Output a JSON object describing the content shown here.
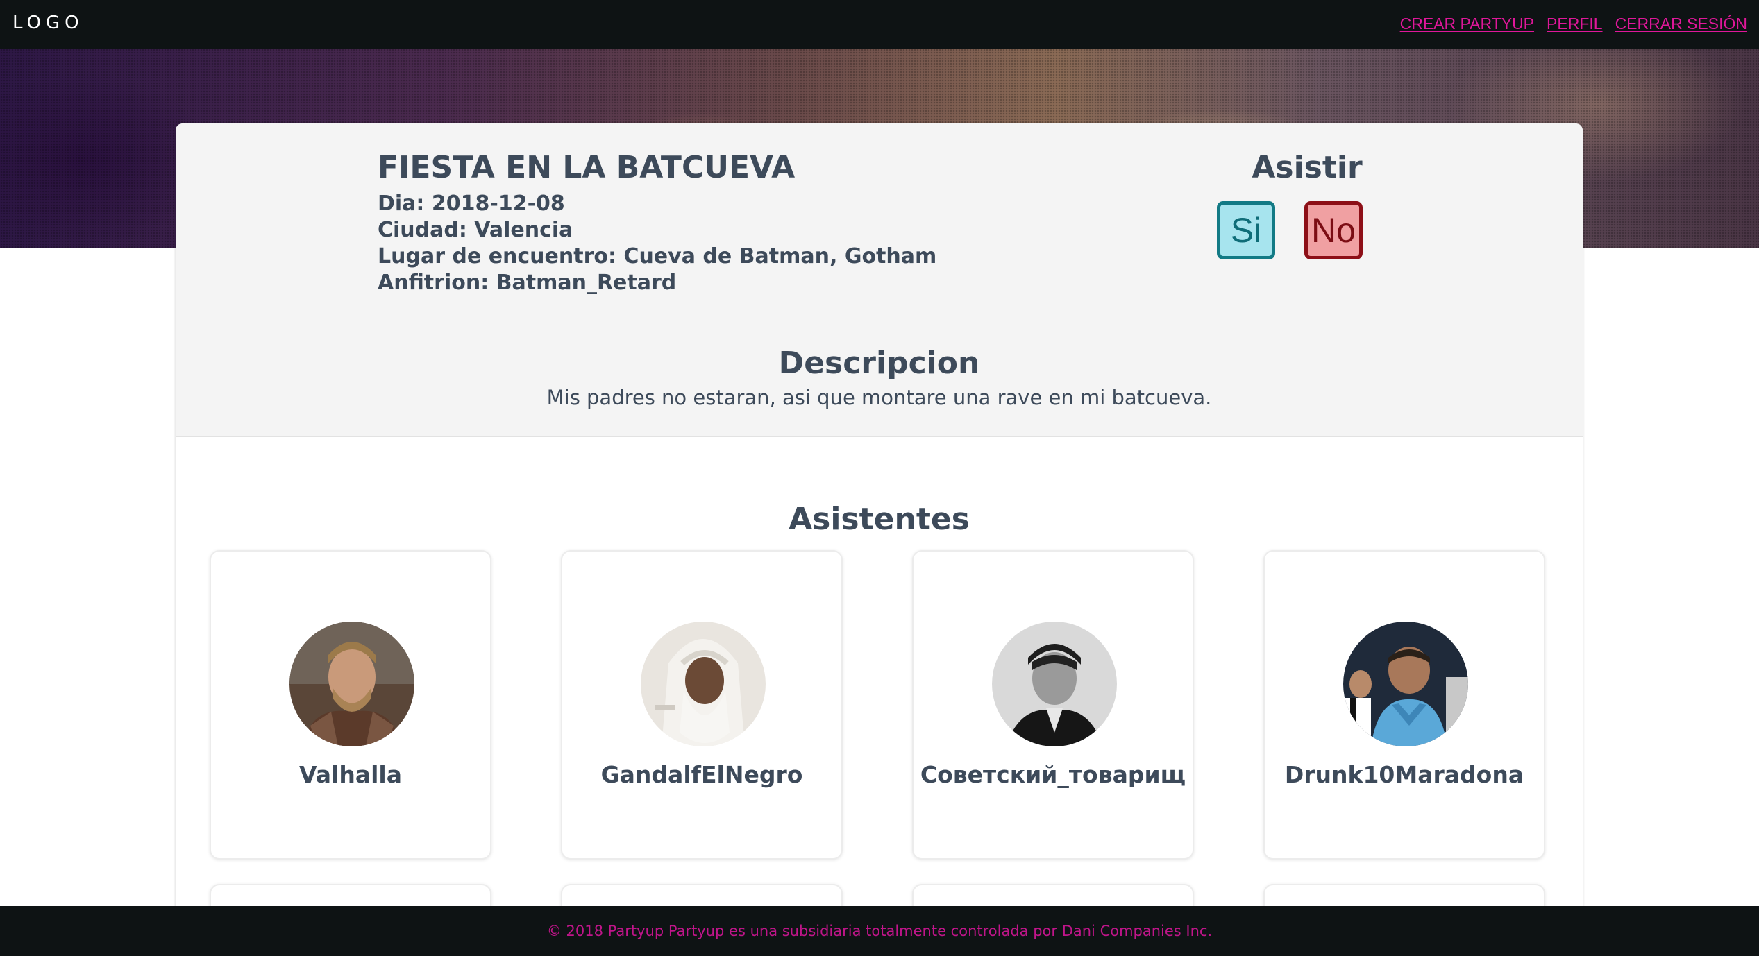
{
  "nav": {
    "logo": "LOGO",
    "links": [
      "CREAR PARTYUP",
      "PERFIL",
      "CERRAR SESIÓN"
    ],
    "link_color": "#e0179a"
  },
  "event": {
    "title": "FIESTA EN LA BATCUEVA",
    "date": "Dia: 2018-12-08",
    "city": "Ciudad: Valencia",
    "place": "Lugar de encuentro: Cueva de Batman, Gotham",
    "host": "Anfitrion: Batman_Retard"
  },
  "assist": {
    "title": "Asistir",
    "yes_label": "Si",
    "no_label": "No"
  },
  "description": {
    "title": "Descripcion",
    "text": "Mis padres no estaran, asi que montare una rave en mi batcueva."
  },
  "attendees": {
    "title": "Asistentes",
    "items": [
      {
        "name": "Valhalla",
        "avatar": "viking-avatar"
      },
      {
        "name": "GandalfElNegro",
        "avatar": "wizard-avatar"
      },
      {
        "name": "Советский_товарищ",
        "avatar": "bw-portrait-avatar"
      },
      {
        "name": "Drunk10Maradona",
        "avatar": "football-fan-avatar"
      }
    ]
  },
  "footer": {
    "text": "© 2018 Partyup Partyup es una subsidiaria totalmente controlada por Dani Companies Inc."
  }
}
